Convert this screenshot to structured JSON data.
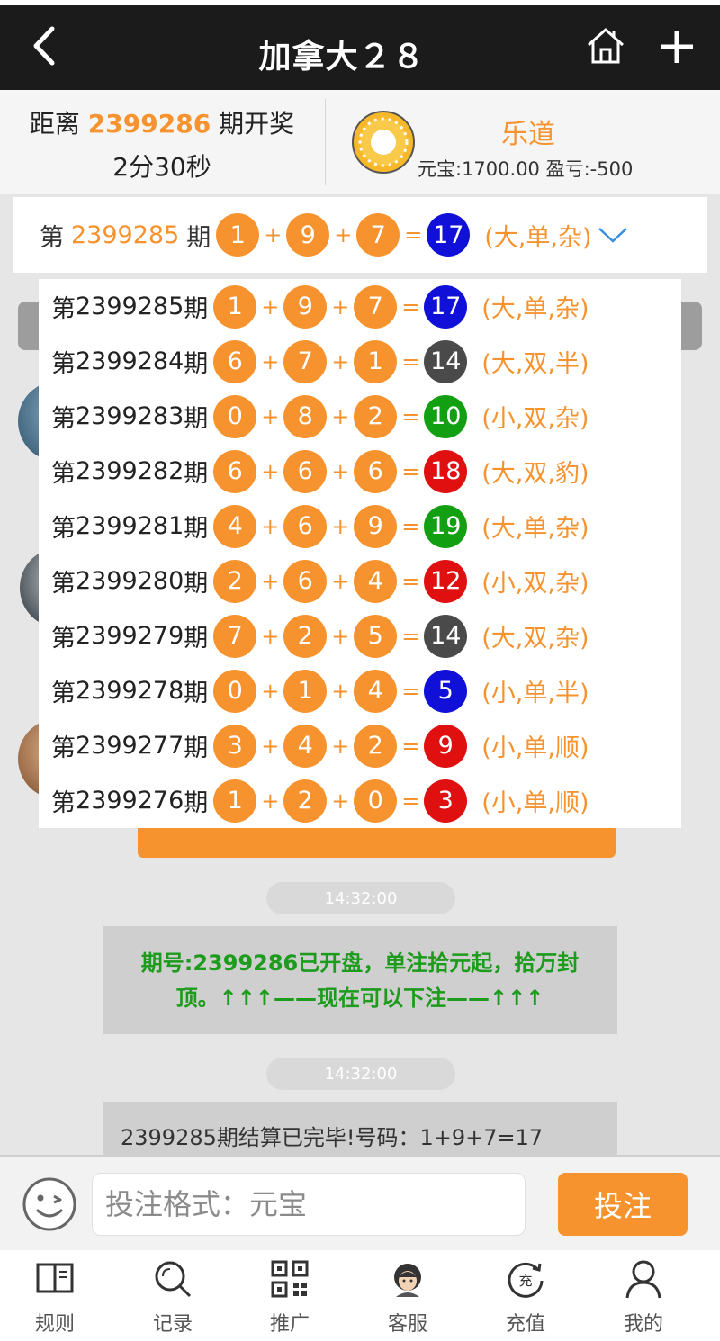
{
  "header": {
    "title": "加拿大２８"
  },
  "countdown": {
    "prefix": "距离",
    "issue": "2399286",
    "suffix": "期开奖",
    "time": "2分30秒"
  },
  "user": {
    "name": "乐道",
    "balance_text": "元宝:1700.00 盈亏:-500"
  },
  "labels": {
    "di": "第",
    "qi": "期",
    "plus": "+",
    "equals": "="
  },
  "latest": {
    "issue": "2399285",
    "n1": "1",
    "n2": "9",
    "n3": "7",
    "sum": "17",
    "result": "(大,单,杂)",
    "sum_color": "#1010d8"
  },
  "history": [
    {
      "issue": "2399285",
      "n1": "1",
      "n2": "9",
      "n3": "7",
      "sum": "17",
      "result": "(大,单,杂)",
      "sum_color": "#1010d8"
    },
    {
      "issue": "2399284",
      "n1": "6",
      "n2": "7",
      "n3": "1",
      "sum": "14",
      "result": "(大,双,半)",
      "sum_color": "#4a4a4a"
    },
    {
      "issue": "2399283",
      "n1": "0",
      "n2": "8",
      "n3": "2",
      "sum": "10",
      "result": "(小,双,杂)",
      "sum_color": "#12a012"
    },
    {
      "issue": "2399282",
      "n1": "6",
      "n2": "6",
      "n3": "6",
      "sum": "18",
      "result": "(大,双,豹)",
      "sum_color": "#e01010"
    },
    {
      "issue": "2399281",
      "n1": "4",
      "n2": "6",
      "n3": "9",
      "sum": "19",
      "result": "(大,单,杂)",
      "sum_color": "#12a012"
    },
    {
      "issue": "2399280",
      "n1": "2",
      "n2": "6",
      "n3": "4",
      "sum": "12",
      "result": "(小,双,杂)",
      "sum_color": "#e01010"
    },
    {
      "issue": "2399279",
      "n1": "7",
      "n2": "2",
      "n3": "5",
      "sum": "14",
      "result": "(大,双,杂)",
      "sum_color": "#4a4a4a"
    },
    {
      "issue": "2399278",
      "n1": "0",
      "n2": "1",
      "n3": "4",
      "sum": "5",
      "result": "(小,单,半)",
      "sum_color": "#1010d8"
    },
    {
      "issue": "2399277",
      "n1": "3",
      "n2": "4",
      "n3": "2",
      "sum": "9",
      "result": "(小,单,顺)",
      "sum_color": "#e01010"
    },
    {
      "issue": "2399276",
      "n1": "1",
      "n2": "2",
      "n3": "0",
      "sum": "3",
      "result": "(小,单,顺)",
      "sum_color": "#e01010"
    }
  ],
  "chat": {
    "time1": "14:32:00",
    "msg1": "期号:2399286已开盘，单注拾元起，拾万封顶。↑↑↑——现在可以下注——↑↑↑",
    "time2": "14:32:00",
    "msg2": "2399285期结算已完毕!号码：1+9+7=17"
  },
  "input": {
    "placeholder": "投注格式：元宝",
    "button": "投注"
  },
  "nav": [
    {
      "label": "规则",
      "icon": "book-icon"
    },
    {
      "label": "记录",
      "icon": "search-icon"
    },
    {
      "label": "推广",
      "icon": "qrcode-icon"
    },
    {
      "label": "客服",
      "icon": "customer-service-icon"
    },
    {
      "label": "充值",
      "icon": "recharge-icon"
    },
    {
      "label": "我的",
      "icon": "user-icon"
    }
  ],
  "colors": {
    "accent": "#f7932e",
    "header_bg": "#1b1b1b",
    "green_text": "#1c9b1c"
  }
}
